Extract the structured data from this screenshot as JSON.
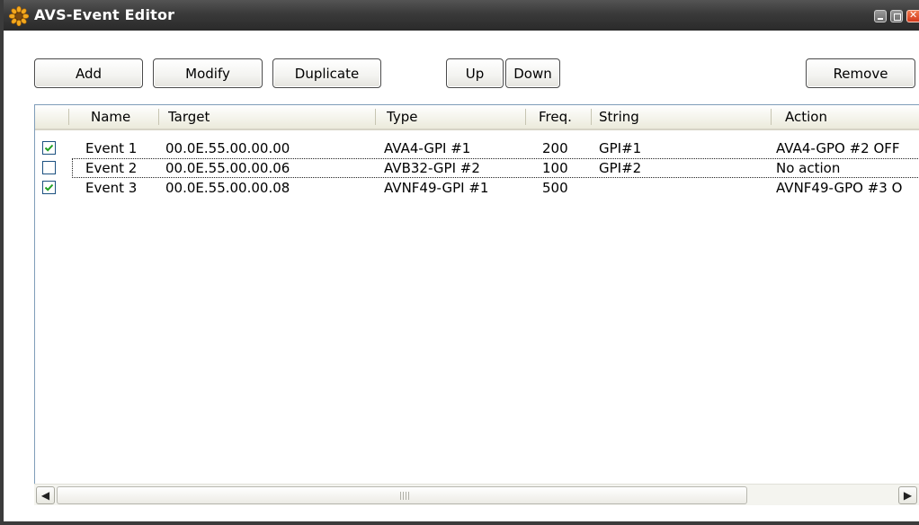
{
  "window": {
    "title": "AVS-Event Editor"
  },
  "toolbar": {
    "add_label": "Add",
    "modify_label": "Modify",
    "duplicate_label": "Duplicate",
    "up_label": "Up",
    "down_label": "Down",
    "remove_label": "Remove"
  },
  "table": {
    "columns": [
      "Name",
      "Target",
      "Type",
      "Freq.",
      "String",
      "Action"
    ],
    "rows": [
      {
        "checked": true,
        "name": "Event 1",
        "target": "00.0E.55.00.00.00",
        "type": "AVA4-GPI #1",
        "freq": "200",
        "string": "GPI#1",
        "action": "AVA4-GPO #2 OFF"
      },
      {
        "checked": false,
        "name": "Event 2",
        "target": "00.0E.55.00.00.06",
        "type": "AVB32-GPI #2",
        "freq": "100",
        "string": "GPI#2",
        "action": "No action"
      },
      {
        "checked": true,
        "name": "Event 3",
        "target": "00.0E.55.00.00.08",
        "type": "AVNF49-GPI #1",
        "freq": "500",
        "string": "",
        "action": "AVNF49-GPO #3 O"
      }
    ],
    "focused_row": 1
  },
  "icons": {
    "app": "sunflower-icon",
    "minimize": "minimize-icon",
    "maximize": "maximize-icon",
    "close": "close-icon",
    "scroll_left": "arrow-left-icon",
    "scroll_right": "arrow-right-icon"
  },
  "colors": {
    "titlebar": "#3a3a3a",
    "close_button": "#d2391b",
    "checkbox_border": "#1c5180",
    "list_border": "#7f9db9"
  }
}
